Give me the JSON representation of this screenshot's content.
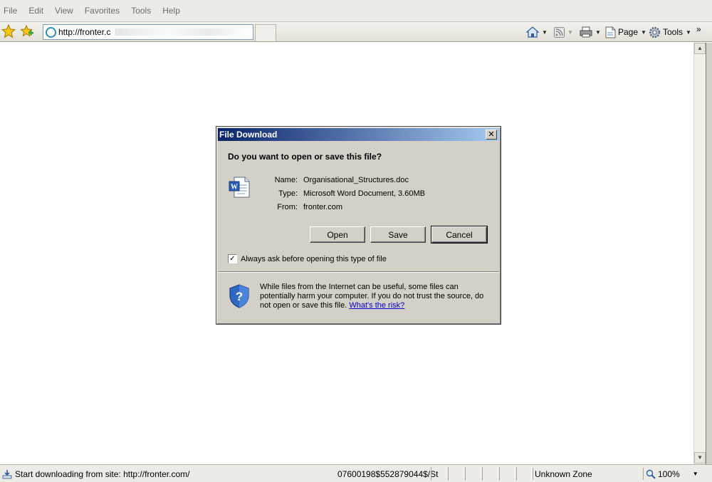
{
  "menubar": {
    "items": [
      "File",
      "Edit",
      "View",
      "Favorites",
      "Tools",
      "Help"
    ]
  },
  "toolbar": {
    "address_url": "http://fronter.c",
    "page_label": "Page",
    "tools_label": "Tools",
    "overflow": "»"
  },
  "dialog": {
    "title": "File Download",
    "close_glyph": "✕",
    "question": "Do you want to open or save this file?",
    "name_label": "Name:",
    "name_value": "Organisational_Structures.doc",
    "type_label": "Type:",
    "type_value": "Microsoft Word Document, 3.60MB",
    "from_label": "From:",
    "from_value": "fronter.com",
    "open_label": "Open",
    "save_label": "Save",
    "cancel_label": "Cancel",
    "checkbox_label": "Always ask before opening this type of file",
    "checkbox_checked": true,
    "warning_text": "While files from the Internet can be useful, some files can potentially harm your computer. If you do not trust the source, do not open or save this file.",
    "risk_link": "What's the risk?"
  },
  "statusbar": {
    "status_text": "Start downloading from site: http://fronter.com/",
    "status_tail": "07600198$552879044$/St",
    "zone": "Unknown Zone",
    "zoom": "100%"
  },
  "colors": {
    "title_gradient_start": "#0a246a",
    "title_gradient_end": "#a6caf0",
    "dialog_face": "#d4d0c8",
    "link": "#0000cc"
  }
}
